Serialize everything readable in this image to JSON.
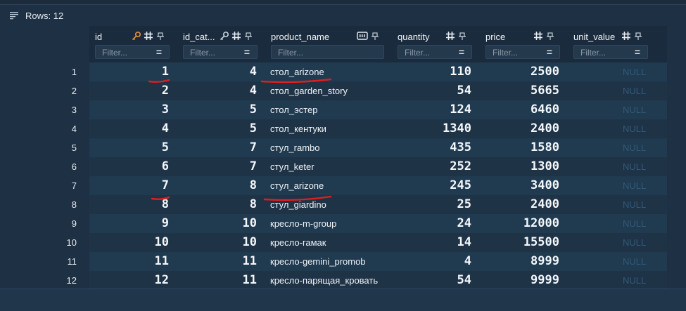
{
  "toolbar": {
    "rows_label": "Rows: 12",
    "icon": "list-lines-icon"
  },
  "columns": [
    {
      "name": "id",
      "icons": [
        "key-icon",
        "hash-icon",
        "pin-icon"
      ],
      "filter_placeholder": "Filter..."
    },
    {
      "name": "id_cat...",
      "icons": [
        "key-icon",
        "hash-icon",
        "pin-icon"
      ],
      "filter_placeholder": "Filter..."
    },
    {
      "name": "product_name",
      "icons": [
        "text-type-icon",
        "pin-icon"
      ],
      "filter_placeholder": "Filter..."
    },
    {
      "name": "quantity",
      "icons": [
        "hash-icon",
        "pin-icon"
      ],
      "filter_placeholder": "Filter..."
    },
    {
      "name": "price",
      "icons": [
        "hash-icon",
        "pin-icon"
      ],
      "filter_placeholder": "Filter..."
    },
    {
      "name": "unit_value",
      "icons": [
        "hash-icon",
        "pin-icon"
      ],
      "filter_placeholder": "Filter..."
    }
  ],
  "rows": [
    {
      "n": "1",
      "id": "1",
      "id_cat": "4",
      "product_name": "стол_arizone",
      "quantity": "110",
      "price": "2500",
      "unit_value": "NULL"
    },
    {
      "n": "2",
      "id": "2",
      "id_cat": "4",
      "product_name": "стол_garden_story",
      "quantity": "54",
      "price": "5665",
      "unit_value": "NULL"
    },
    {
      "n": "3",
      "id": "3",
      "id_cat": "5",
      "product_name": "стол_эстер",
      "quantity": "124",
      "price": "6460",
      "unit_value": "NULL"
    },
    {
      "n": "4",
      "id": "4",
      "id_cat": "5",
      "product_name": "стол_кентуки",
      "quantity": "1340",
      "price": "2400",
      "unit_value": "NULL"
    },
    {
      "n": "5",
      "id": "5",
      "id_cat": "7",
      "product_name": "стул_rambo",
      "quantity": "435",
      "price": "1580",
      "unit_value": "NULL"
    },
    {
      "n": "6",
      "id": "6",
      "id_cat": "7",
      "product_name": "стул_keter",
      "quantity": "252",
      "price": "1300",
      "unit_value": "NULL"
    },
    {
      "n": "7",
      "id": "7",
      "id_cat": "8",
      "product_name": "стул_arizone",
      "quantity": "245",
      "price": "3400",
      "unit_value": "NULL"
    },
    {
      "n": "8",
      "id": "8",
      "id_cat": "8",
      "product_name": "стул_giardino",
      "quantity": "25",
      "price": "2400",
      "unit_value": "NULL"
    },
    {
      "n": "9",
      "id": "9",
      "id_cat": "10",
      "product_name": "кресло-m-group",
      "quantity": "24",
      "price": "12000",
      "unit_value": "NULL"
    },
    {
      "n": "10",
      "id": "10",
      "id_cat": "10",
      "product_name": "кресло-гамак",
      "quantity": "14",
      "price": "15500",
      "unit_value": "NULL"
    },
    {
      "n": "11",
      "id": "11",
      "id_cat": "11",
      "product_name": "кресло-gemini_promob",
      "quantity": "4",
      "price": "8999",
      "unit_value": "NULL"
    },
    {
      "n": "12",
      "id": "12",
      "id_cat": "11",
      "product_name": "кресло-парящая_кровать",
      "quantity": "54",
      "price": "9999",
      "unit_value": "NULL"
    }
  ],
  "colors": {
    "annotation": "#e01e1e",
    "key": "#e8953a"
  }
}
